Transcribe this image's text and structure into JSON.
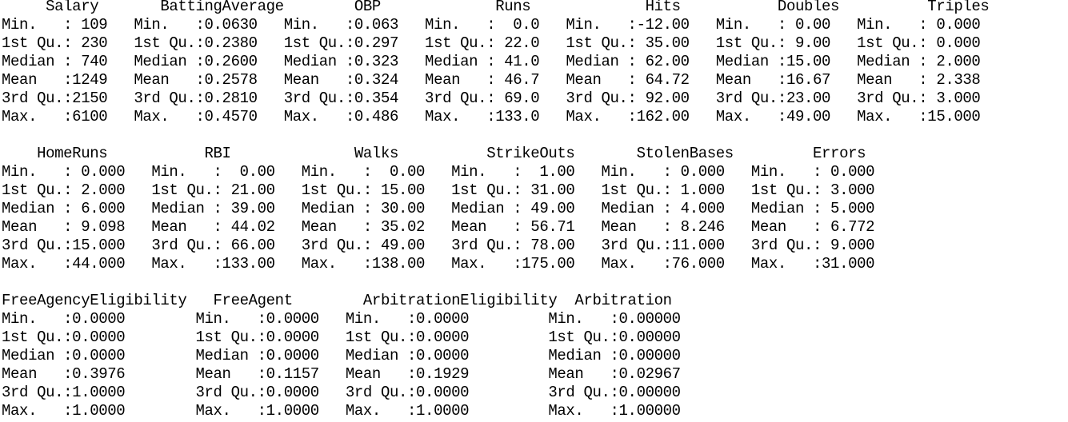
{
  "console_output": {
    "lines": [
      "     Salary       BattingAverage        OBP             Runs             Hits           Doubles          Triples      ",
      "Min.   : 109   Min.   :0.0630   Min.   :0.063   Min.   :  0.0   Min.   :-12.00   Min.   : 0.00   Min.   : 0.000  ",
      "1st Qu.: 230   1st Qu.:0.2380   1st Qu.:0.297   1st Qu.: 22.0   1st Qu.: 35.00   1st Qu.: 9.00   1st Qu.: 0.000  ",
      "Median : 740   Median :0.2600   Median :0.323   Median : 41.0   Median : 62.00   Median :15.00   Median : 2.000  ",
      "Mean   :1249   Mean   :0.2578   Mean   :0.324   Mean   : 46.7   Mean   : 64.72   Mean   :16.67   Mean   : 2.338  ",
      "3rd Qu.:2150   3rd Qu.:0.2810   3rd Qu.:0.354   3rd Qu.: 69.0   3rd Qu.: 92.00   3rd Qu.:23.00   3rd Qu.: 3.000  ",
      "Max.   :6100   Max.   :0.4570   Max.   :0.486   Max.   :133.0   Max.   :162.00   Max.   :49.00   Max.   :15.000  ",
      "",
      "    HomeRuns           RBI              Walks          StrikeOuts       StolenBases         Errors      ",
      "Min.   : 0.000   Min.   :  0.00   Min.   :  0.00   Min.   :  1.00   Min.   : 0.000   Min.   : 0.000  ",
      "1st Qu.: 2.000   1st Qu.: 21.00   1st Qu.: 15.00   1st Qu.: 31.00   1st Qu.: 1.000   1st Qu.: 3.000  ",
      "Median : 6.000   Median : 39.00   Median : 30.00   Median : 49.00   Median : 4.000   Median : 5.000  ",
      "Mean   : 9.098   Mean   : 44.02   Mean   : 35.02   Mean   : 56.71   Mean   : 8.246   Mean   : 6.772  ",
      "3rd Qu.:15.000   3rd Qu.: 66.00   3rd Qu.: 49.00   3rd Qu.: 78.00   3rd Qu.:11.000   3rd Qu.: 9.000  ",
      "Max.   :44.000   Max.   :133.00   Max.   :138.00   Max.   :175.00   Max.   :76.000   Max.   :31.000  ",
      "",
      "FreeAgencyEligibility   FreeAgent        ArbitrationEligibility  Arbitration     ",
      "Min.   :0.0000        Min.   :0.0000   Min.   :0.0000         Min.   :0.00000  ",
      "1st Qu.:0.0000        1st Qu.:0.0000   1st Qu.:0.0000         1st Qu.:0.00000  ",
      "Median :0.0000        Median :0.0000   Median :0.0000         Median :0.00000  ",
      "Mean   :0.3976        Mean   :0.1157   Mean   :0.1929         Mean   :0.02967  ",
      "3rd Qu.:1.0000        3rd Qu.:0.0000   3rd Qu.:0.0000         3rd Qu.:0.00000  ",
      "Max.   :1.0000        Max.   :1.0000   Max.   :1.0000         Max.   :1.00000  "
    ]
  }
}
